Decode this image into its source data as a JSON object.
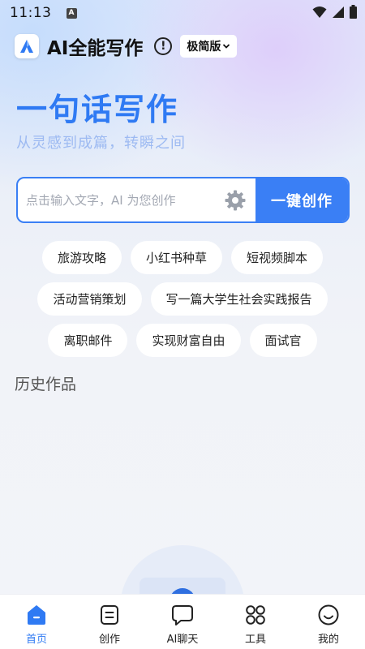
{
  "status_bar": {
    "time": "11:13",
    "notification_badge": "A",
    "icons": [
      "wifi-icon",
      "signal-icon",
      "battery-icon"
    ]
  },
  "header": {
    "app_name": "AI全能写作",
    "info_icon": "info-icon",
    "version_selected": "极简版"
  },
  "hero": {
    "title": "一句话写作",
    "subtitle": "从灵感到成篇，转瞬之间"
  },
  "prompt": {
    "placeholder": "点击输入文字，AI 为您创作",
    "value": "",
    "create_button_label": "一键创作"
  },
  "suggestions": [
    [
      "旅游攻略",
      "小红书种草",
      "短视频脚本"
    ],
    [
      "活动营销策划",
      "写一篇大学生社会实践报告"
    ],
    [
      "离职邮件",
      "实现财富自由",
      "面试官"
    ]
  ],
  "history": {
    "title": "历史作品"
  },
  "tab_bar": {
    "tabs": [
      {
        "label": "首页",
        "icon": "home-icon",
        "active": true
      },
      {
        "label": "创作",
        "icon": "create-icon",
        "active": false
      },
      {
        "label": "AI聊天",
        "icon": "chat-icon",
        "active": false
      },
      {
        "label": "工具",
        "icon": "tools-icon",
        "active": false
      },
      {
        "label": "我的",
        "icon": "profile-icon",
        "active": false
      }
    ]
  },
  "colors": {
    "accent": "#3a7ff5",
    "hero_title": "#2f7af3",
    "hero_subtitle": "#9dbaf2",
    "chip_background": "#ffffff",
    "tab_active": "#2f7af3"
  }
}
